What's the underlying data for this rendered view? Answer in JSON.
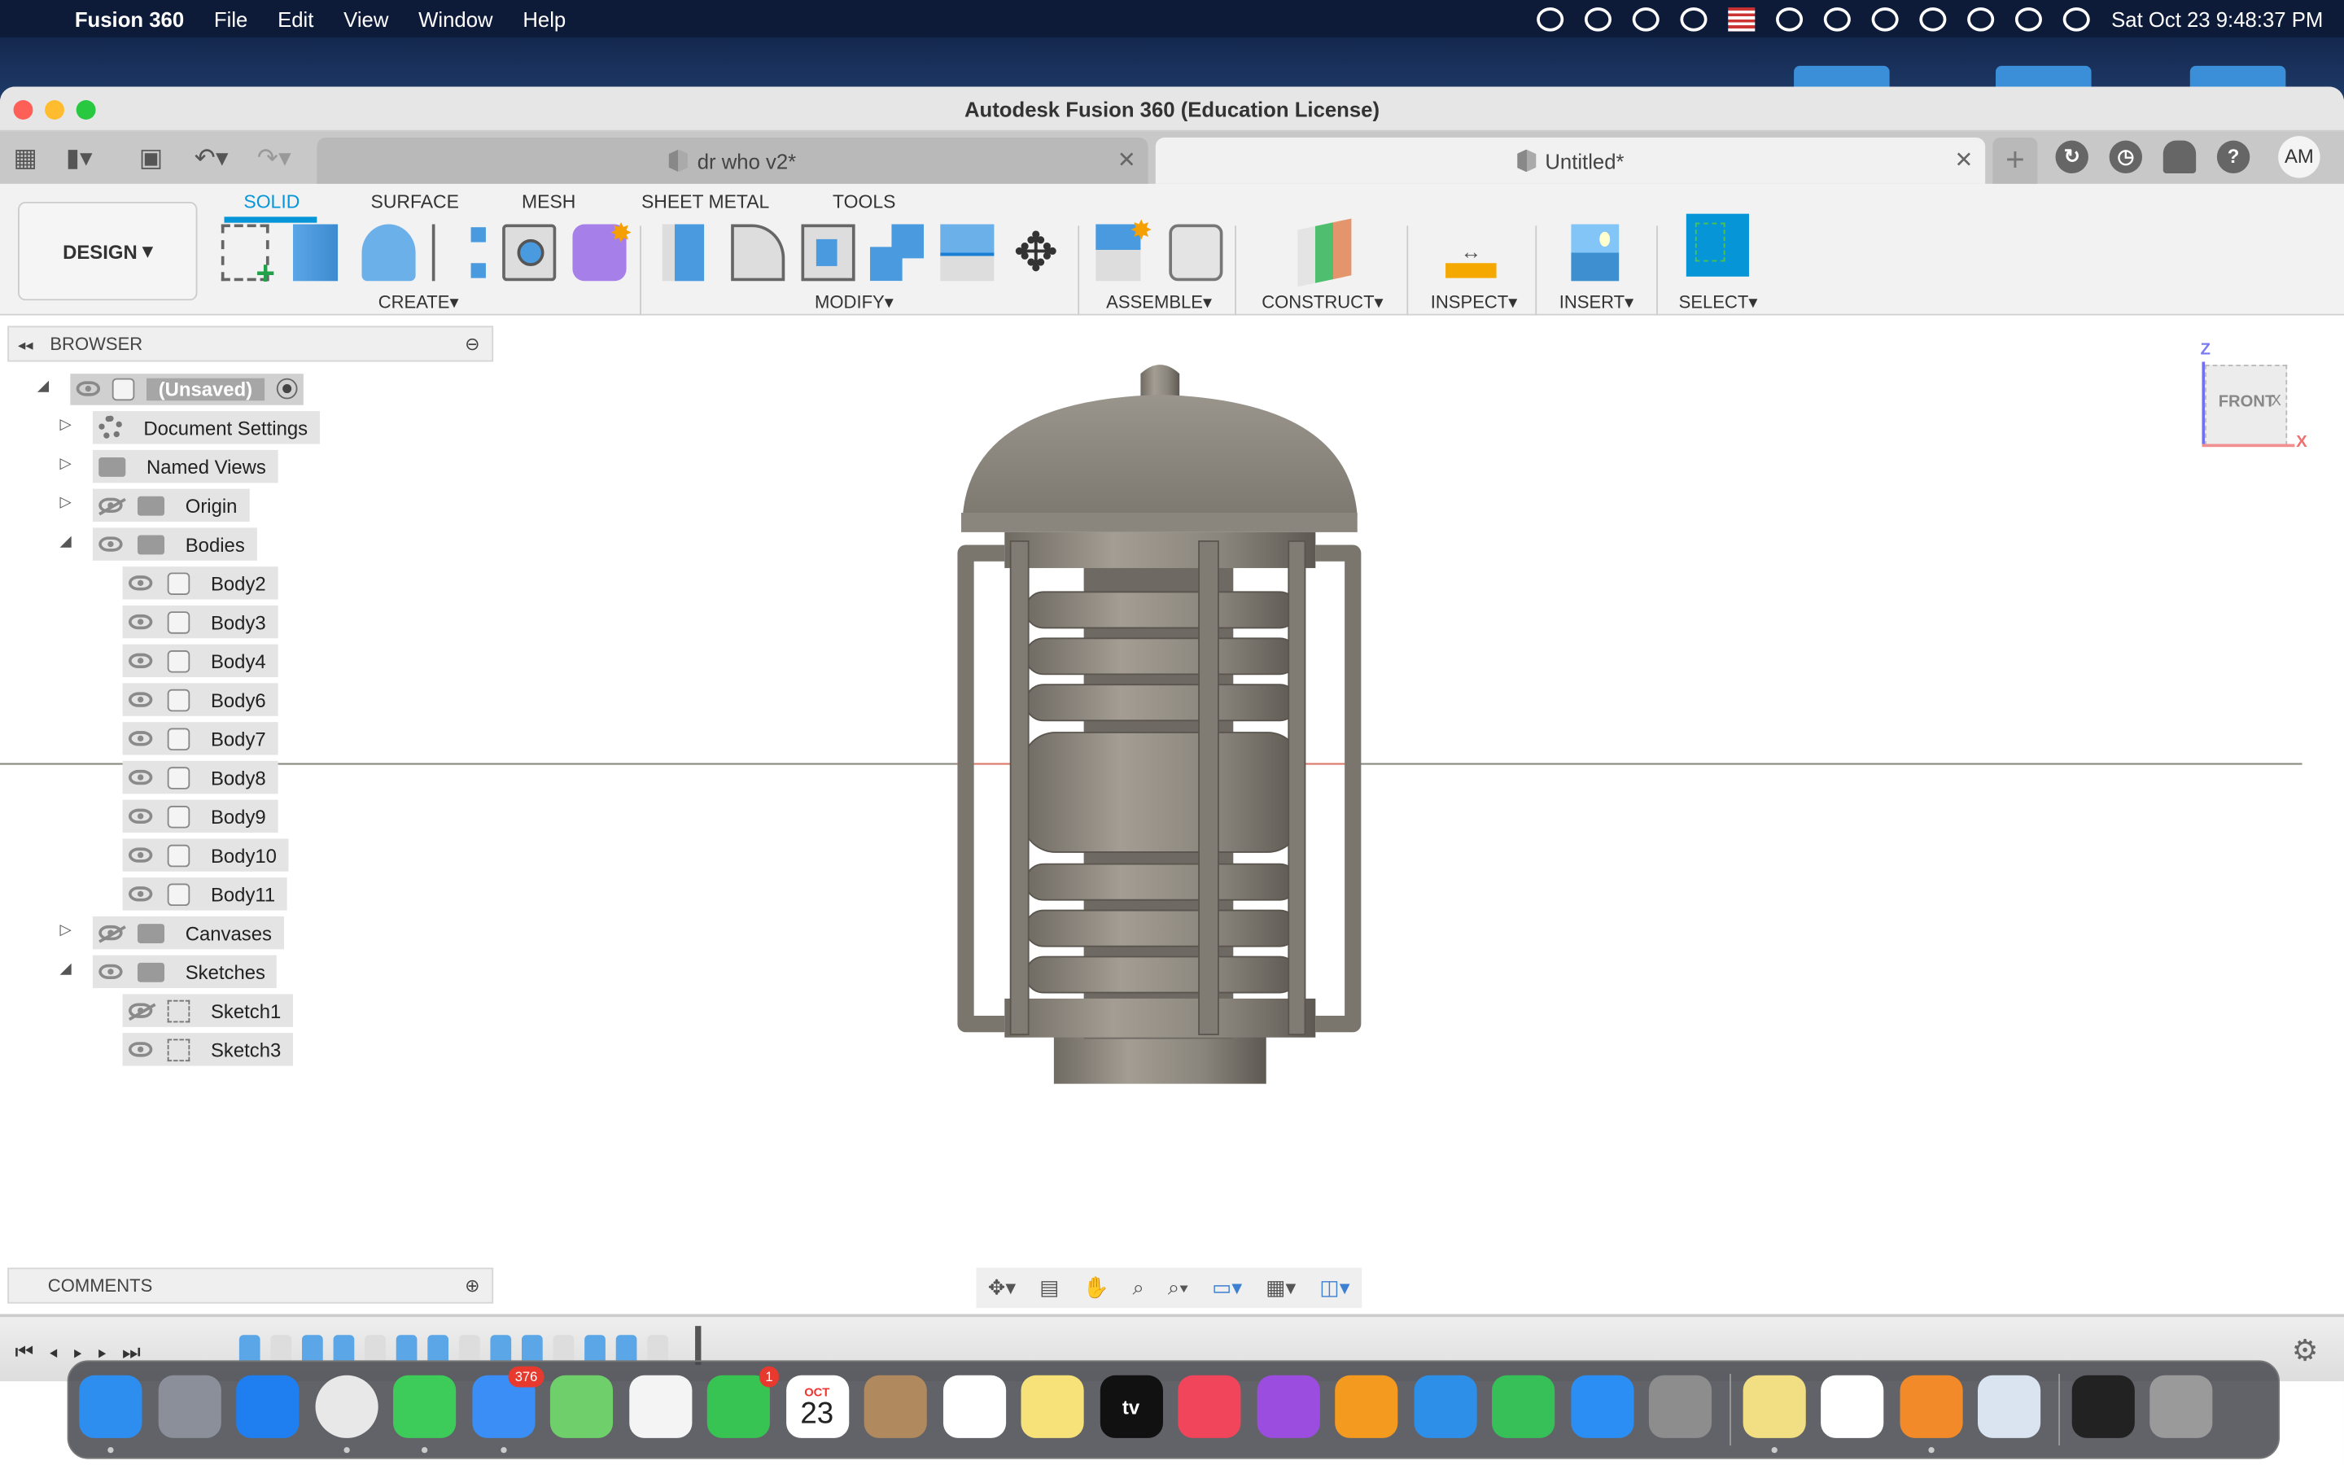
{
  "menubar": {
    "app_name": "Fusion 360",
    "menus": [
      "File",
      "Edit",
      "View",
      "Window",
      "Help"
    ],
    "status_icons": [
      "creative-cloud-icon",
      "bartender-icon",
      "play-icon",
      "bluetooth-icon",
      "us-flag-icon",
      "battery-charging-icon",
      "wifi-icon",
      "user-icon",
      "time-machine-icon",
      "spotlight-search-icon",
      "control-center-icon",
      "siri-icon"
    ],
    "datetime": "Sat Oct 23  9:48:37 PM"
  },
  "window": {
    "title": "Autodesk Fusion 360 (Education License)"
  },
  "tabs": [
    {
      "label": "dr who v2*",
      "active": false
    },
    {
      "label": "Untitled*",
      "active": true
    }
  ],
  "user_initials": "AM",
  "toolbar": {
    "workspace": "DESIGN",
    "workspace_tabs": [
      "SOLID",
      "SURFACE",
      "MESH",
      "SHEET METAL",
      "TOOLS"
    ],
    "groups": [
      "CREATE",
      "MODIFY",
      "ASSEMBLE",
      "CONSTRUCT",
      "INSPECT",
      "INSERT",
      "SELECT"
    ]
  },
  "browser": {
    "title": "BROWSER",
    "root": "(Unsaved)",
    "items": [
      {
        "label": "Document Settings",
        "level": 1,
        "icon": "gear",
        "eye": "none",
        "expand": "collapsed"
      },
      {
        "label": "Named Views",
        "level": 1,
        "icon": "folder",
        "eye": "none",
        "expand": "collapsed"
      },
      {
        "label": "Origin",
        "level": 1,
        "icon": "folder",
        "eye": "hidden",
        "expand": "collapsed"
      },
      {
        "label": "Bodies",
        "level": 1,
        "icon": "folder",
        "eye": "visible",
        "expand": "expanded"
      },
      {
        "label": "Body2",
        "level": 2,
        "icon": "body",
        "eye": "visible",
        "expand": "none"
      },
      {
        "label": "Body3",
        "level": 2,
        "icon": "body",
        "eye": "visible",
        "expand": "none"
      },
      {
        "label": "Body4",
        "level": 2,
        "icon": "body",
        "eye": "visible",
        "expand": "none"
      },
      {
        "label": "Body6",
        "level": 2,
        "icon": "body",
        "eye": "visible",
        "expand": "none"
      },
      {
        "label": "Body7",
        "level": 2,
        "icon": "body",
        "eye": "visible",
        "expand": "none"
      },
      {
        "label": "Body8",
        "level": 2,
        "icon": "body",
        "eye": "visible",
        "expand": "none"
      },
      {
        "label": "Body9",
        "level": 2,
        "icon": "body",
        "eye": "visible",
        "expand": "none"
      },
      {
        "label": "Body10",
        "level": 2,
        "icon": "body",
        "eye": "visible",
        "expand": "none"
      },
      {
        "label": "Body11",
        "level": 2,
        "icon": "body",
        "eye": "visible",
        "expand": "none"
      },
      {
        "label": "Canvases",
        "level": 1,
        "icon": "folder",
        "eye": "hidden",
        "expand": "collapsed"
      },
      {
        "label": "Sketches",
        "level": 1,
        "icon": "folder",
        "eye": "visible",
        "expand": "expanded"
      },
      {
        "label": "Sketch1",
        "level": 2,
        "icon": "sketch",
        "eye": "hidden",
        "expand": "none"
      },
      {
        "label": "Sketch3",
        "level": 2,
        "icon": "sketch",
        "eye": "visible",
        "expand": "none"
      }
    ]
  },
  "viewcube": {
    "face": "FRONT",
    "side": "X",
    "axis_z": "Z",
    "axis_x": "X"
  },
  "comments": {
    "title": "COMMENTS"
  },
  "dock": [
    {
      "name": "finder",
      "color": "#2d8ef0"
    },
    {
      "name": "launchpad",
      "color": "#8a8f99"
    },
    {
      "name": "safari",
      "color": "#1f7ff0"
    },
    {
      "name": "chrome",
      "color": "#e8e8e8"
    },
    {
      "name": "messages",
      "color": "#3dcc5a"
    },
    {
      "name": "mail",
      "color": "#3a8ef5",
      "badge": "376"
    },
    {
      "name": "maps",
      "color": "#6fcf6a"
    },
    {
      "name": "photos",
      "color": "#f4f4f4"
    },
    {
      "name": "facetime",
      "color": "#37c453",
      "badge": "1"
    },
    {
      "name": "calendar",
      "color": "#ffffff",
      "month": "OCT",
      "day": "23"
    },
    {
      "name": "contacts",
      "color": "#b08a5e"
    },
    {
      "name": "reminders",
      "color": "#ffffff"
    },
    {
      "name": "notes",
      "color": "#f7e27a"
    },
    {
      "name": "apple-tv",
      "color": "#111111",
      "text": "tv"
    },
    {
      "name": "music",
      "color": "#f0455a"
    },
    {
      "name": "podcasts",
      "color": "#9b4de0"
    },
    {
      "name": "pages",
      "color": "#f39a1f"
    },
    {
      "name": "keynote",
      "color": "#2e8fe8"
    },
    {
      "name": "numbers",
      "color": "#37c057"
    },
    {
      "name": "app-store",
      "color": "#2a8ef5"
    },
    {
      "name": "system-preferences",
      "color": "#8d8d8d"
    },
    {
      "name": "stickies",
      "color": "#f2df84"
    },
    {
      "name": "autodesk-app",
      "color": "#ffffff"
    },
    {
      "name": "fusion-360",
      "color": "#f28a2a"
    },
    {
      "name": "preview",
      "color": "#d9e4f0"
    },
    {
      "name": "screenshot",
      "color": "#222222"
    },
    {
      "name": "trash",
      "color": "#9a9a9a"
    }
  ]
}
